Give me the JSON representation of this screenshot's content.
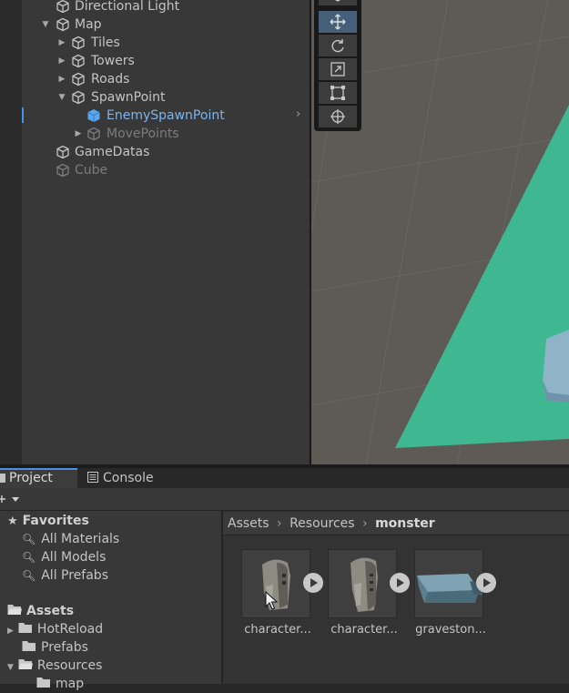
{
  "hierarchy": {
    "items": [
      {
        "label": "Directional Light",
        "state": "normal"
      },
      {
        "label": "Map",
        "state": "expanded"
      },
      {
        "label": "Tiles",
        "state": "collapsed"
      },
      {
        "label": "Towers",
        "state": "collapsed"
      },
      {
        "label": "Roads",
        "state": "collapsed"
      },
      {
        "label": "SpawnPoint",
        "state": "expanded"
      },
      {
        "label": "EnemySpawnPoint",
        "state": "selected"
      },
      {
        "label": "MovePoints",
        "state": "disabled-collapsed"
      },
      {
        "label": "GameDatas",
        "state": "normal"
      },
      {
        "label": "Cube",
        "state": "disabled"
      }
    ]
  },
  "scene": {
    "tools": [
      "hand-tool",
      "move-tool",
      "rotate-tool",
      "scale-tool",
      "rect-tool",
      "transform-tool"
    ],
    "active_tool": "move-tool",
    "ground_color": "#3fb891"
  },
  "tabs": {
    "project": "Project",
    "console": "Console"
  },
  "favorites": {
    "header": "Favorites",
    "items": [
      "All Materials",
      "All Models",
      "All Prefabs"
    ]
  },
  "assets_tree": {
    "header": "Assets",
    "items": [
      "HotReload",
      "Prefabs",
      "Resources",
      "map"
    ]
  },
  "breadcrumb": [
    "Assets",
    "Resources",
    "monster"
  ],
  "assets": [
    {
      "label": "character...",
      "icon": "character-model-icon"
    },
    {
      "label": "character...",
      "icon": "character-model-icon"
    },
    {
      "label": "graveston...",
      "icon": "gravestone-model-icon"
    }
  ],
  "colors": {
    "accent": "#4d8ee6",
    "selected_text": "#7bb4f0"
  }
}
